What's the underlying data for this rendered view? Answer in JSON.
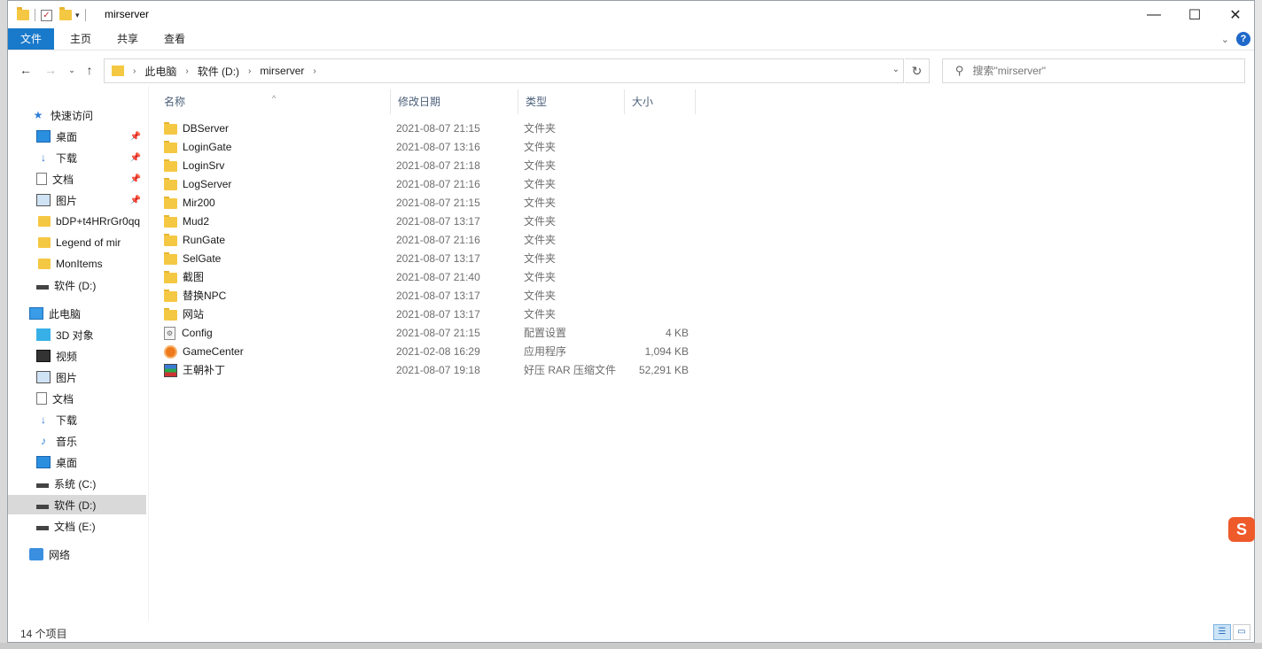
{
  "window": {
    "title": "mirserver"
  },
  "ribbon": {
    "tabs": [
      "文件",
      "主页",
      "共享",
      "查看"
    ]
  },
  "address": {
    "crumbs": [
      "此电脑",
      "软件 (D:)",
      "mirserver"
    ]
  },
  "search": {
    "placeholder": "搜索\"mirserver\""
  },
  "nav": {
    "quick_access": "快速访问",
    "quick_items": [
      {
        "label": "桌面",
        "icon": "desktop-icon",
        "pinned": true
      },
      {
        "label": "下载",
        "icon": "download-icon",
        "pinned": true
      },
      {
        "label": "文档",
        "icon": "document-icon",
        "pinned": true
      },
      {
        "label": "图片",
        "icon": "picture-icon",
        "pinned": true
      },
      {
        "label": "bDP+t4HRrGr0qq",
        "icon": "folder-icon",
        "pinned": false
      },
      {
        "label": "Legend of mir",
        "icon": "folder-icon",
        "pinned": false
      },
      {
        "label": "MonItems",
        "icon": "folder-icon",
        "pinned": false
      },
      {
        "label": "软件 (D:)",
        "icon": "drive-icon",
        "pinned": false
      }
    ],
    "this_pc": "此电脑",
    "pc_items": [
      {
        "label": "3D 对象",
        "icon": "3d-objects-icon"
      },
      {
        "label": "视频",
        "icon": "video-icon"
      },
      {
        "label": "图片",
        "icon": "picture-icon"
      },
      {
        "label": "文档",
        "icon": "document-icon"
      },
      {
        "label": "下载",
        "icon": "download-icon"
      },
      {
        "label": "音乐",
        "icon": "music-icon"
      },
      {
        "label": "桌面",
        "icon": "desktop-icon"
      },
      {
        "label": "系统 (C:)",
        "icon": "system-drive-icon"
      },
      {
        "label": "软件 (D:)",
        "icon": "drive-icon",
        "selected": true
      },
      {
        "label": "文档 (E:)",
        "icon": "drive-icon"
      }
    ],
    "network": "网络"
  },
  "columns": {
    "name": "名称",
    "date": "修改日期",
    "type": "类型",
    "size": "大小"
  },
  "files": [
    {
      "name": "DBServer",
      "date": "2021-08-07 21:15",
      "type": "文件夹",
      "size": "",
      "icon": "folder"
    },
    {
      "name": "LoginGate",
      "date": "2021-08-07 13:16",
      "type": "文件夹",
      "size": "",
      "icon": "folder"
    },
    {
      "name": "LoginSrv",
      "date": "2021-08-07 21:18",
      "type": "文件夹",
      "size": "",
      "icon": "folder"
    },
    {
      "name": "LogServer",
      "date": "2021-08-07 21:16",
      "type": "文件夹",
      "size": "",
      "icon": "folder"
    },
    {
      "name": "Mir200",
      "date": "2021-08-07 21:15",
      "type": "文件夹",
      "size": "",
      "icon": "folder"
    },
    {
      "name": "Mud2",
      "date": "2021-08-07 13:17",
      "type": "文件夹",
      "size": "",
      "icon": "folder"
    },
    {
      "name": "RunGate",
      "date": "2021-08-07 21:16",
      "type": "文件夹",
      "size": "",
      "icon": "folder"
    },
    {
      "name": "SelGate",
      "date": "2021-08-07 13:17",
      "type": "文件夹",
      "size": "",
      "icon": "folder"
    },
    {
      "name": "截图",
      "date": "2021-08-07 21:40",
      "type": "文件夹",
      "size": "",
      "icon": "folder"
    },
    {
      "name": "替换NPC",
      "date": "2021-08-07 13:17",
      "type": "文件夹",
      "size": "",
      "icon": "folder"
    },
    {
      "name": "网站",
      "date": "2021-08-07 13:17",
      "type": "文件夹",
      "size": "",
      "icon": "folder"
    },
    {
      "name": "Config",
      "date": "2021-08-07 21:15",
      "type": "配置设置",
      "size": "4 KB",
      "icon": "config"
    },
    {
      "name": "GameCenter",
      "date": "2021-02-08 16:29",
      "type": "应用程序",
      "size": "1,094 KB",
      "icon": "app"
    },
    {
      "name": "王朝补丁",
      "date": "2021-08-07 19:18",
      "type": "好压 RAR 压缩文件",
      "size": "52,291 KB",
      "icon": "rar"
    }
  ],
  "status": {
    "count": "14 个项目"
  }
}
